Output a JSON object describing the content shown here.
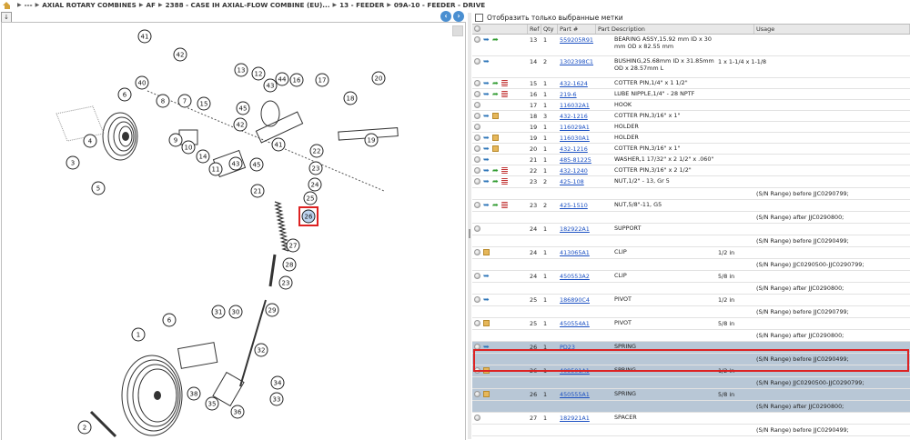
{
  "breadcrumb": [
    "---",
    "AXIAL ROTARY COMBINES",
    "AF",
    "2388 - CASE IH AXIAL-FLOW COMBINE (EU)...",
    "13 - FEEDER",
    "09A-10 - FEEDER - DRIVE"
  ],
  "breadcrumb_sep": "▶",
  "nav": {
    "back": "‹",
    "forward": "›"
  },
  "left_tool": "↓",
  "filter_label": "Отобразить только выбранные метки",
  "columns": {
    "ref": "Ref",
    "qty": "Qty",
    "part": "Part #",
    "desc": "Part Description",
    "usage": "Usage"
  },
  "diagram_callouts": [
    "41",
    "42",
    "40",
    "13",
    "12",
    "44",
    "16",
    "17",
    "18",
    "20",
    "6",
    "8",
    "7",
    "15",
    "43",
    "45",
    "9",
    "10",
    "42",
    "14",
    "11",
    "43",
    "41",
    "45",
    "22",
    "4",
    "5",
    "3",
    "19",
    "23",
    "21",
    "24",
    "25",
    "26",
    "27",
    "28",
    "23",
    "29",
    "31",
    "30",
    "32",
    "6",
    "1",
    "34",
    "38",
    "35",
    "33",
    "36",
    "2"
  ],
  "highlight_callout": "26",
  "rows": [
    {
      "icons": [
        "dot",
        "fish",
        "arrow"
      ],
      "ref": "13",
      "qty": "1",
      "part": "559205R91",
      "desc": "BEARING ASSY,15.92 mm ID x 30 mm OD x 82.55 mm",
      "usage": "",
      "h": 24
    },
    {
      "icons": [
        "dot",
        "fish"
      ],
      "ref": "14",
      "qty": "2",
      "part": "1302398C1",
      "desc": "BUSHING,25.68mm ID x 31.85mm OD x 28.57mm L",
      "usage": "1 x 1-1/4 x 1-1/8",
      "h": 24
    },
    {
      "icons": [
        "dot",
        "fish",
        "arrow",
        "lines"
      ],
      "ref": "15",
      "qty": "1",
      "part": "432-1624",
      "desc": "COTTER PIN,1/4\" x 1 1/2\"",
      "usage": "",
      "h": 12
    },
    {
      "icons": [
        "dot",
        "fish",
        "arrow",
        "lines"
      ],
      "ref": "16",
      "qty": "1",
      "part": "219-6",
      "desc": "LUBE NIPPLE,1/4\" - 28 NPTF",
      "usage": "",
      "h": 12
    },
    {
      "icons": [
        "dot"
      ],
      "ref": "17",
      "qty": "1",
      "part": "116032A1",
      "desc": "HOOK",
      "usage": "",
      "h": 12
    },
    {
      "icons": [
        "dot",
        "fish",
        "box"
      ],
      "ref": "18",
      "qty": "3",
      "part": "432-1216",
      "desc": "COTTER PIN,3/16\" x 1\"",
      "usage": "",
      "h": 12
    },
    {
      "icons": [
        "dot"
      ],
      "ref": "19",
      "qty": "1",
      "part": "116029A1",
      "desc": "HOLDER",
      "usage": "",
      "h": 12
    },
    {
      "icons": [
        "dot",
        "fish",
        "box"
      ],
      "ref": "19",
      "qty": "1",
      "part": "116030A1",
      "desc": "HOLDER",
      "usage": "",
      "h": 12
    },
    {
      "icons": [
        "dot",
        "fish",
        "box"
      ],
      "ref": "20",
      "qty": "1",
      "part": "432-1216",
      "desc": "COTTER PIN,3/16\" x 1\"",
      "usage": "",
      "h": 12
    },
    {
      "icons": [
        "dot",
        "fish"
      ],
      "ref": "21",
      "qty": "1",
      "part": "485-81225",
      "desc": "WASHER,1 17/32\" x 2 1/2\" x .060\"",
      "usage": "",
      "h": 12
    },
    {
      "icons": [
        "dot",
        "fish",
        "arrow",
        "lines"
      ],
      "ref": "22",
      "qty": "1",
      "part": "432-1240",
      "desc": "COTTER PIN,3/16\" x 2 1/2\"",
      "usage": "",
      "h": 12
    },
    {
      "icons": [
        "dot",
        "fish",
        "arrow",
        "lines"
      ],
      "ref": "23",
      "qty": "2",
      "part": "425-108",
      "desc": "NUT,1/2\" - 13, Gr 5",
      "usage": "",
      "h": 13
    },
    {
      "sub": "(S/N Range) before JJC0290799;"
    },
    {
      "icons": [
        "dot",
        "fish",
        "arrow",
        "lines"
      ],
      "ref": "23",
      "qty": "2",
      "part": "425-1510",
      "desc": "NUT,5/8\"-11, G5",
      "usage": "",
      "h": 13
    },
    {
      "sub": "(S/N Range) after JJC0290800;"
    },
    {
      "icons": [
        "dot"
      ],
      "ref": "24",
      "qty": "1",
      "part": "182922A1",
      "desc": "SUPPORT",
      "usage": "",
      "h": 13
    },
    {
      "sub": "(S/N Range) before JJC0290499;"
    },
    {
      "icons": [
        "dot",
        "box"
      ],
      "ref": "24",
      "qty": "1",
      "part": "413065A1",
      "desc": "CLIP",
      "usage": "1/2 in",
      "h": 13
    },
    {
      "sub": "(S/N Range) JJC0290500-JJC0290799;"
    },
    {
      "icons": [
        "dot",
        "fish"
      ],
      "ref": "24",
      "qty": "1",
      "part": "450553A2",
      "desc": "CLIP",
      "usage": "5/8 in",
      "h": 13
    },
    {
      "sub": "(S/N Range) after JJC0290800;"
    },
    {
      "icons": [
        "dot",
        "fish"
      ],
      "ref": "25",
      "qty": "1",
      "part": "186890C4",
      "desc": "PIVOT",
      "usage": "1/2 in",
      "h": 13
    },
    {
      "sub": "(S/N Range) before JJC0290799;"
    },
    {
      "icons": [
        "dot",
        "box"
      ],
      "ref": "25",
      "qty": "1",
      "part": "450554A1",
      "desc": "PIVOT",
      "usage": "5/8 in",
      "h": 13
    },
    {
      "sub": "(S/N Range) after JJC0290800;"
    },
    {
      "icons": [
        "dot",
        "fish"
      ],
      "ref": "26",
      "qty": "1",
      "part": "PD23",
      "desc": "SPRING",
      "usage": "",
      "h": 13,
      "hl": true
    },
    {
      "sub": "(S/N Range) before JJC0290499;",
      "hl": true
    },
    {
      "icons": [
        "dot",
        "box"
      ],
      "ref": "26",
      "qty": "1",
      "part": "409501A1",
      "desc": "SPRING",
      "usage": "1/2 in",
      "h": 13,
      "hl": true
    },
    {
      "sub": "(S/N Range) JJC0290500-JJC0290799;",
      "hl": true
    },
    {
      "icons": [
        "dot",
        "box"
      ],
      "ref": "26",
      "qty": "1",
      "part": "450555A1",
      "desc": "SPRING",
      "usage": "5/8 in",
      "h": 13,
      "hl": true
    },
    {
      "sub": "(S/N Range) after JJC0290800;",
      "hl": true
    },
    {
      "icons": [
        "dot"
      ],
      "ref": "27",
      "qty": "1",
      "part": "182921A1",
      "desc": "SPACER",
      "usage": "",
      "h": 13
    },
    {
      "sub": "(S/N Range) before JJC0290499;"
    }
  ]
}
